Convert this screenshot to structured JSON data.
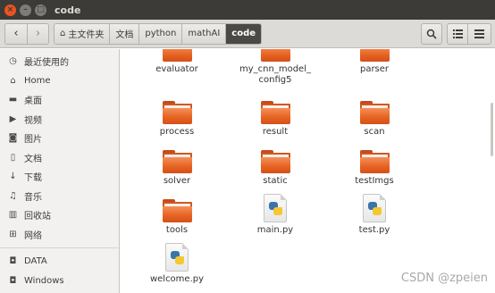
{
  "window": {
    "title": "code"
  },
  "window_controls": {
    "close": "×",
    "minimize": "–",
    "maximize": "□"
  },
  "nav": {
    "back": "‹",
    "forward": "›"
  },
  "breadcrumbs": [
    {
      "label": "主文件夹",
      "icon": "home-icon"
    },
    {
      "label": "文档"
    },
    {
      "label": "python"
    },
    {
      "label": "mathAI"
    },
    {
      "label": "code",
      "active": true
    }
  ],
  "toolbar": {
    "search_icon": "🔍",
    "list_icon": "☰",
    "menu_icon": "⋮"
  },
  "sidebar": {
    "items": [
      {
        "label": "最近使用的",
        "icon": "clock-icon",
        "glyph": "◷"
      },
      {
        "label": "Home",
        "icon": "home-icon",
        "glyph": "⌂"
      },
      {
        "label": "桌面",
        "icon": "folder-icon",
        "glyph": "▬"
      },
      {
        "label": "视频",
        "icon": "video-icon",
        "glyph": "▶"
      },
      {
        "label": "图片",
        "icon": "camera-icon",
        "glyph": "◙"
      },
      {
        "label": "文档",
        "icon": "document-icon",
        "glyph": "▯"
      },
      {
        "label": "下载",
        "icon": "download-icon",
        "glyph": "↓"
      },
      {
        "label": "音乐",
        "icon": "music-icon",
        "glyph": "♫"
      },
      {
        "label": "回收站",
        "icon": "trash-icon",
        "glyph": "▥"
      },
      {
        "label": "网络",
        "icon": "network-icon",
        "glyph": "⊞"
      }
    ],
    "drives": [
      {
        "label": "DATA",
        "icon": "drive-icon",
        "glyph": "◘"
      },
      {
        "label": "Windows",
        "icon": "drive-icon",
        "glyph": "◘"
      }
    ]
  },
  "files": [
    {
      "name": "evaluator",
      "type": "folder"
    },
    {
      "name": "my_cnn_model_\nconfig5",
      "type": "folder"
    },
    {
      "name": "parser",
      "type": "folder"
    },
    {
      "name": "process",
      "type": "folder"
    },
    {
      "name": "result",
      "type": "folder"
    },
    {
      "name": "scan",
      "type": "folder"
    },
    {
      "name": "solver",
      "type": "folder"
    },
    {
      "name": "static",
      "type": "folder"
    },
    {
      "name": "testImgs",
      "type": "folder"
    },
    {
      "name": "tools",
      "type": "folder"
    },
    {
      "name": "main.py",
      "type": "python"
    },
    {
      "name": "test.py",
      "type": "python"
    },
    {
      "name": "welcome.py",
      "type": "python"
    }
  ],
  "watermark": "CSDN @zpeien"
}
